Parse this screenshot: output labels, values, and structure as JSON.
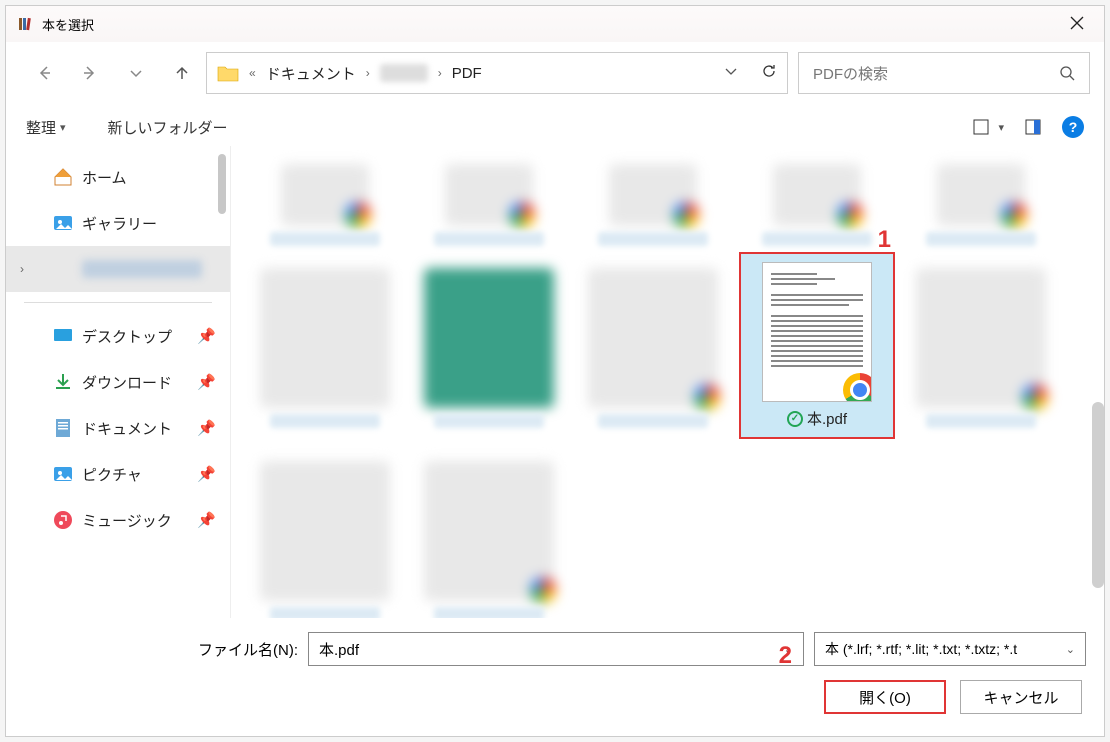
{
  "title": "本を選択",
  "breadcrumb": {
    "seg1": "ドキュメント",
    "seg3": "PDF",
    "laquo": "«",
    "chev": "›"
  },
  "search": {
    "placeholder": "PDFの検索"
  },
  "toolbar": {
    "organize": "整理",
    "newfolder": "新しいフォルダー"
  },
  "sidebar": {
    "home": "ホーム",
    "gallery": "ギャラリー",
    "desktop": "デスクトップ",
    "downloads": "ダウンロード",
    "documents": "ドキュメント",
    "pictures": "ピクチャ",
    "music": "ミュージック"
  },
  "selected_file": {
    "name": "本.pdf"
  },
  "bottom": {
    "label": "ファイル名(N):",
    "filename": "本.pdf",
    "filter": "本 (*.lrf; *.rtf; *.lit; *.txt; *.txtz; *.t",
    "open": "開く(O)",
    "cancel": "キャンセル"
  },
  "annotations": {
    "one": "1",
    "two": "2"
  }
}
